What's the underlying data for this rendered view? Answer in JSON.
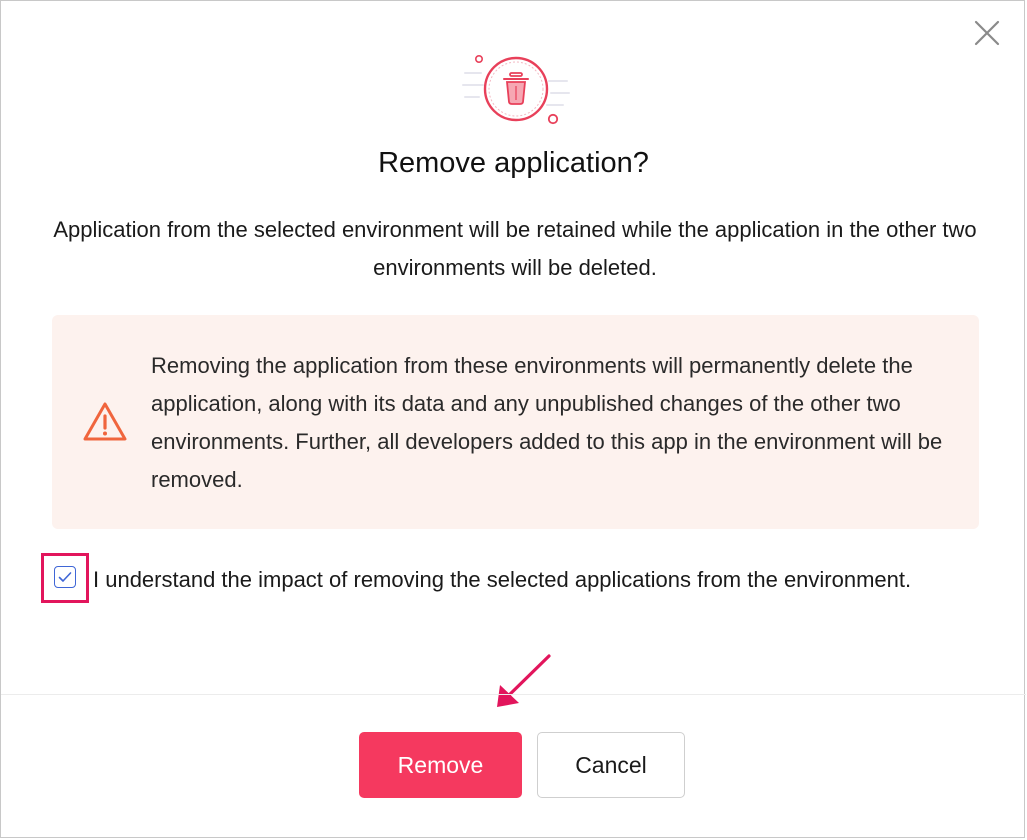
{
  "dialog": {
    "title": "Remove application?",
    "description": "Application from the selected environment will be retained while the application in the other two environments will be deleted.",
    "warning": {
      "text": "Removing the application from these environments will permanently delete the application, along with its data and any unpublished changes of the other two environments. Further, all developers added to this app in the environment will be removed.",
      "icon": "warning-triangle-icon"
    },
    "consent": {
      "checked": true,
      "label": "I understand the impact of removing the selected applications from the environment."
    },
    "actions": {
      "remove_label": "Remove",
      "cancel_label": "Cancel"
    },
    "close_icon": "close-icon",
    "hero_icon": "trash-icon"
  },
  "colors": {
    "accent": "#f5395f",
    "warning_bg": "#fdf2ee",
    "warning_icon": "#f0653d",
    "checkbox": "#3f66d6",
    "annotation": "#e2155c"
  }
}
